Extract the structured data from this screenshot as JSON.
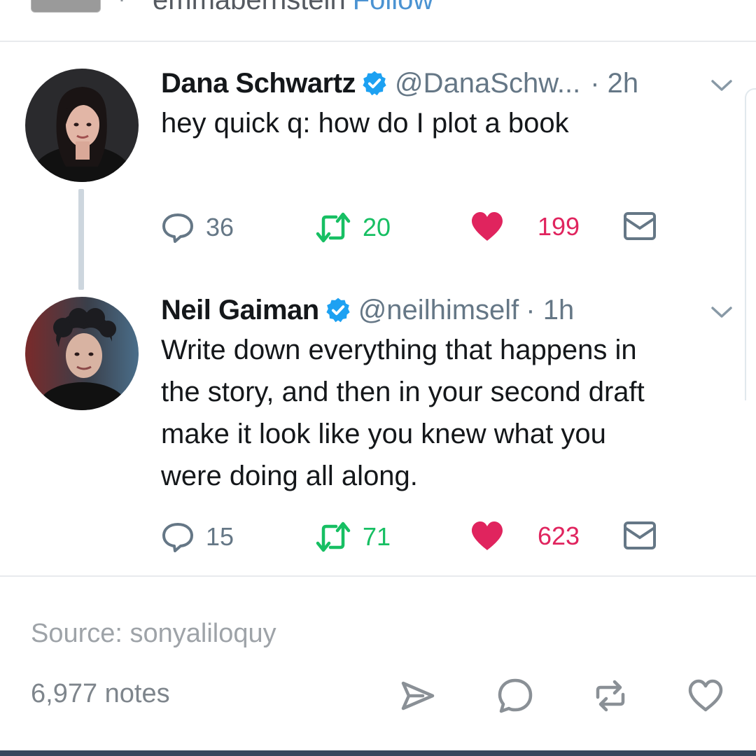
{
  "header": {
    "reblogged_from": "emmabernstein",
    "follow_label": "Follow"
  },
  "tweets": [
    {
      "name": "Dana Schwartz",
      "handle": "@DanaSchw...",
      "time": "· 2h",
      "text": "hey quick q: how do I plot a book",
      "replies": "36",
      "retweets": "20",
      "likes": "199"
    },
    {
      "name": "Neil Gaiman",
      "handle": "@neilhimself",
      "time": "· 1h",
      "text_lines": [
        "Write down everything that happens in",
        "the story, and then in your second draft",
        "make it look like you knew what you",
        "were doing all along."
      ],
      "replies": "15",
      "retweets": "71",
      "likes": "623"
    }
  ],
  "post": {
    "source": "Source: sonyaliloquy",
    "notes": "6,977 notes"
  },
  "icons": {
    "verified": "verified-badge-icon",
    "reply": "reply-bubble-icon",
    "retweet": "retweet-icon",
    "like": "heart-icon",
    "dm": "envelope-icon",
    "share": "paper-plane-icon",
    "reblog": "reblog-icon",
    "comment": "comment-bubble-icon",
    "heart_outline": "heart-outline-icon"
  },
  "colors": {
    "verified": "#1da1f2",
    "retweet": "#17bf63",
    "like": "#e0245e",
    "muted": "#657786",
    "tumblr_navy": "#36465d"
  }
}
